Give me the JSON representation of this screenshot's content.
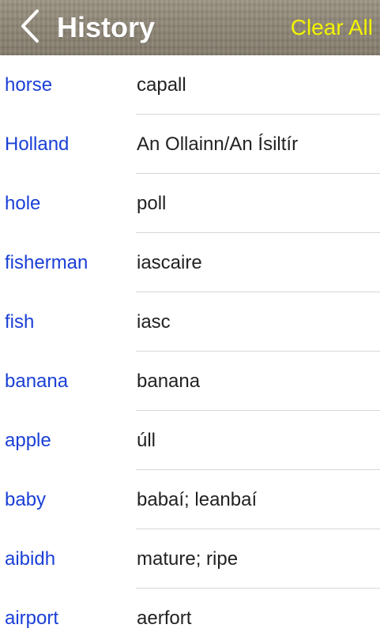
{
  "header": {
    "title": "History",
    "clear_label": "Clear All",
    "back_icon": "chevron-left-icon"
  },
  "colors": {
    "term": "#1a3fd6",
    "translation": "#222222",
    "clear": "#f4f400",
    "title": "#ffffff"
  },
  "history": [
    {
      "term": "horse",
      "translation": "capall"
    },
    {
      "term": "Holland",
      "translation": "An Ollainn/An Ísiltír"
    },
    {
      "term": "hole",
      "translation": "poll"
    },
    {
      "term": "fisherman",
      "translation": "iascaire"
    },
    {
      "term": "fish",
      "translation": "iasc"
    },
    {
      "term": "banana",
      "translation": "banana"
    },
    {
      "term": "apple",
      "translation": "úll"
    },
    {
      "term": "baby",
      "translation": "babaí; leanbaí"
    },
    {
      "term": "aibidh",
      "translation": "mature; ripe"
    },
    {
      "term": "airport",
      "translation": "aerfort"
    }
  ]
}
